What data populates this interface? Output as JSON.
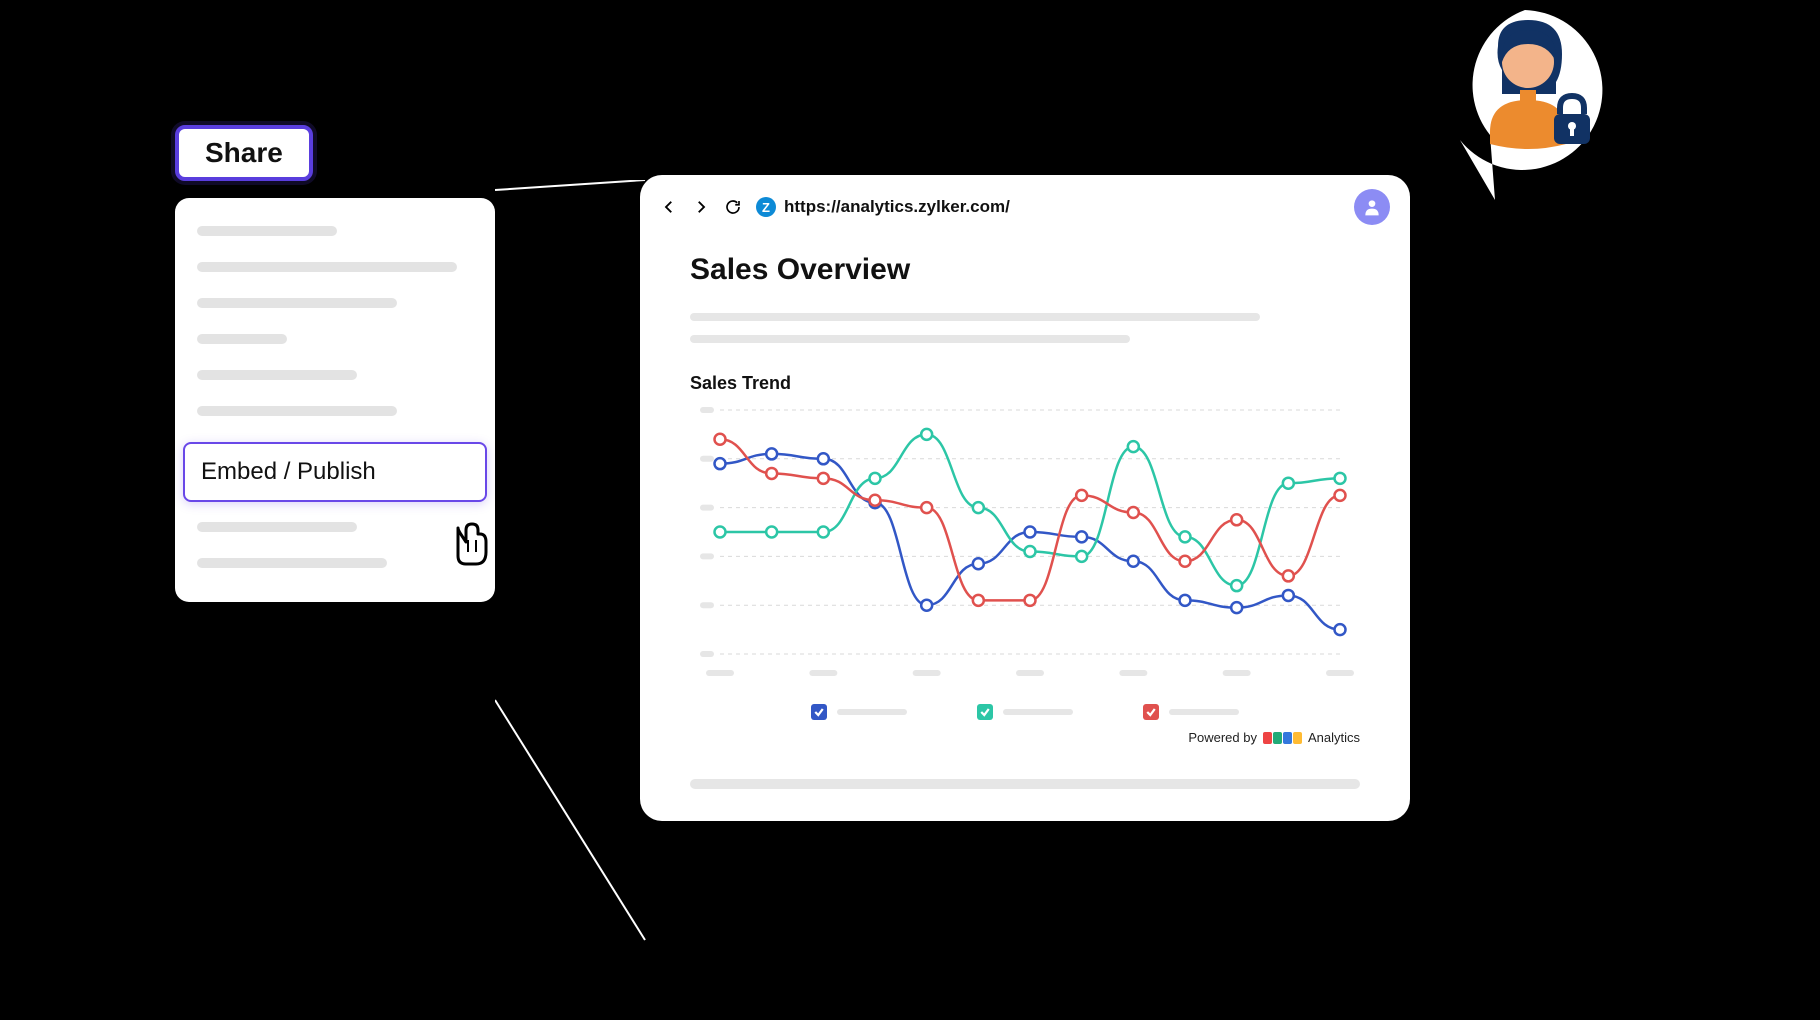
{
  "share_button": "Share",
  "menu": {
    "highlighted": "Embed / Publish"
  },
  "browser": {
    "url": "https://analytics.zylker.com/",
    "favicon_letter": "Z",
    "page_title": "Sales Overview",
    "chart_title": "Sales Trend",
    "powered_prefix": "Powered by",
    "powered_suffix": "Analytics"
  },
  "colors": {
    "accent": "#5a3ede",
    "series_blue": "#3257c6",
    "series_green": "#2cc6a6",
    "series_red": "#e0514e"
  },
  "chart_data": {
    "type": "line",
    "x": [
      1,
      2,
      3,
      4,
      5,
      6,
      7,
      8,
      9,
      10,
      11,
      12,
      13
    ],
    "series": [
      {
        "name": "blue",
        "values": [
          78,
          82,
          80,
          62,
          20,
          37,
          50,
          48,
          38,
          22,
          19,
          24,
          10
        ]
      },
      {
        "name": "green",
        "values": [
          50,
          50,
          50,
          72,
          90,
          60,
          42,
          40,
          85,
          48,
          28,
          70,
          72
        ]
      },
      {
        "name": "red",
        "values": [
          88,
          74,
          72,
          63,
          60,
          22,
          22,
          65,
          58,
          38,
          55,
          32,
          65
        ]
      }
    ],
    "ylim": [
      0,
      100
    ],
    "grid_rows": 6
  }
}
